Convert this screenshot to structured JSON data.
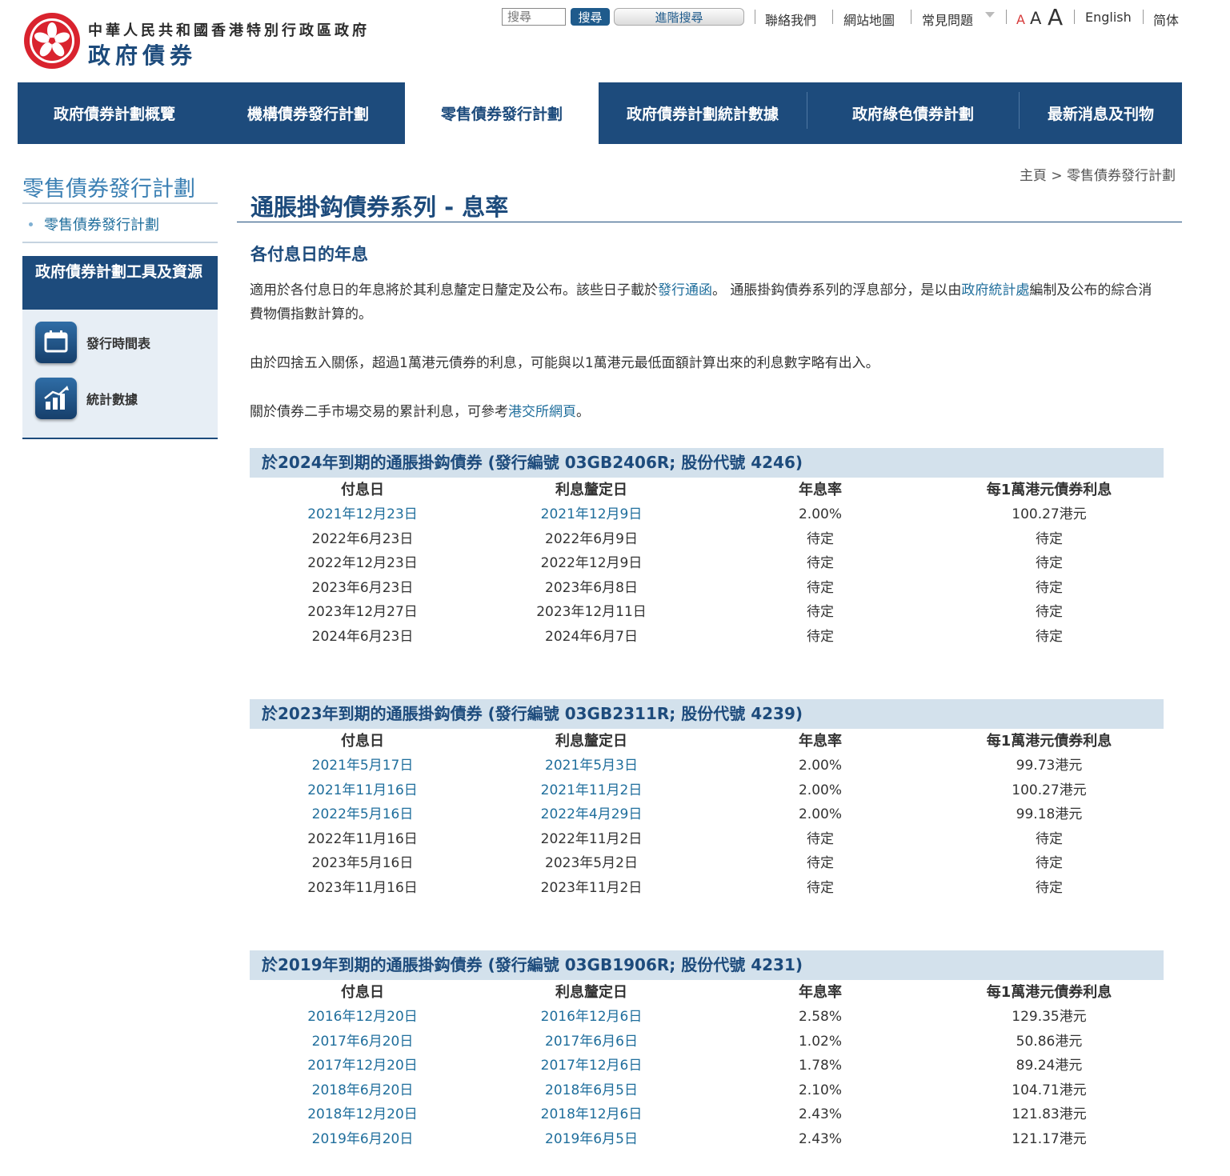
{
  "header": {
    "gov_name": "中華人民共和國香港特別行政區政府",
    "site_name": "政府債券",
    "search_placeholder": "搜尋",
    "search_button": "搜尋",
    "advanced_search": "進階搜尋",
    "links": {
      "contact": "聯絡我們",
      "sitemap": "網站地圖",
      "faq": "常見問題",
      "english": "English",
      "simplified": "简体"
    },
    "font_sizes": [
      "A",
      "A",
      "A"
    ]
  },
  "nav": {
    "tabs": [
      "政府債券計劃概覽",
      "機構債券發行計劃",
      "零售債券發行計劃",
      "政府債券計劃統計數據",
      "政府綠色債券計劃",
      "最新消息及刊物"
    ],
    "active_index": 2
  },
  "sidebar": {
    "title": "零售債券發行計劃",
    "link": "零售債券發行計劃",
    "tools_title": "政府債券計劃工具及資源",
    "tools": [
      {
        "label": "發行時間表",
        "icon": "calendar-icon"
      },
      {
        "label": "統計數據",
        "icon": "bar-chart-icon"
      }
    ]
  },
  "breadcrumb": {
    "home": "主頁",
    "sep": ">",
    "current": "零售債券發行計劃"
  },
  "page": {
    "title": "通脹掛鈎債券系列 - 息率",
    "subheading": "各付息日的年息",
    "para1": {
      "t1": "適用於各付息日的年息將於其利息釐定日釐定及公布。該些日子載於",
      "link1": "發行通函",
      "t2": "。 通脹掛鈎債券系列的浮息部分，是以由",
      "link2": "政府統計處",
      "t3": "編制及公布的綜合消費物價指數計算的。"
    },
    "para2": "由於四捨五入關係，超過1萬港元債券的利息，可能與以1萬港元最低面額計算出來的利息數字略有出入。",
    "para3": {
      "t1": "關於債券二手市場交易的累計利息，可參考",
      "link": "港交所網頁",
      "t2": "。"
    }
  },
  "table_headers": [
    "付息日",
    "利息釐定日",
    "年息率",
    "每1萬港元債券利息"
  ],
  "bonds": [
    {
      "title": "於2024年到期的通脹掛鈎債券 (發行編號 03GB2406R; 股份代號 4246)",
      "rows": [
        {
          "pay": "2021年12月23日",
          "fix": "2021年12月9日",
          "rate": "2.00%",
          "interest": "100.27港元",
          "linked": true
        },
        {
          "pay": "2022年6月23日",
          "fix": "2022年6月9日",
          "rate": "待定",
          "interest": "待定",
          "linked": false
        },
        {
          "pay": "2022年12月23日",
          "fix": "2022年12月9日",
          "rate": "待定",
          "interest": "待定",
          "linked": false
        },
        {
          "pay": "2023年6月23日",
          "fix": "2023年6月8日",
          "rate": "待定",
          "interest": "待定",
          "linked": false
        },
        {
          "pay": "2023年12月27日",
          "fix": "2023年12月11日",
          "rate": "待定",
          "interest": "待定",
          "linked": false
        },
        {
          "pay": "2024年6月23日",
          "fix": "2024年6月7日",
          "rate": "待定",
          "interest": "待定",
          "linked": false
        }
      ]
    },
    {
      "title": "於2023年到期的通脹掛鈎債券 (發行編號 03GB2311R; 股份代號 4239)",
      "rows": [
        {
          "pay": "2021年5月17日",
          "fix": "2021年5月3日",
          "rate": "2.00%",
          "interest": "99.73港元",
          "linked": true
        },
        {
          "pay": "2021年11月16日",
          "fix": "2021年11月2日",
          "rate": "2.00%",
          "interest": "100.27港元",
          "linked": true
        },
        {
          "pay": "2022年5月16日",
          "fix": "2022年4月29日",
          "rate": "2.00%",
          "interest": "99.18港元",
          "linked": true
        },
        {
          "pay": "2022年11月16日",
          "fix": "2022年11月2日",
          "rate": "待定",
          "interest": "待定",
          "linked": false
        },
        {
          "pay": "2023年5月16日",
          "fix": "2023年5月2日",
          "rate": "待定",
          "interest": "待定",
          "linked": false
        },
        {
          "pay": "2023年11月16日",
          "fix": "2023年11月2日",
          "rate": "待定",
          "interest": "待定",
          "linked": false
        }
      ]
    },
    {
      "title": "於2019年到期的通脹掛鈎債券 (發行編號 03GB1906R; 股份代號 4231)",
      "rows": [
        {
          "pay": "2016年12月20日",
          "fix": "2016年12月6日",
          "rate": "2.58%",
          "interest": "129.35港元",
          "linked": true
        },
        {
          "pay": "2017年6月20日",
          "fix": "2017年6月6日",
          "rate": "1.02%",
          "interest": "50.86港元",
          "linked": true
        },
        {
          "pay": "2017年12月20日",
          "fix": "2017年12月6日",
          "rate": "1.78%",
          "interest": "89.24港元",
          "linked": true
        },
        {
          "pay": "2018年6月20日",
          "fix": "2018年6月5日",
          "rate": "2.10%",
          "interest": "104.71港元",
          "linked": true
        },
        {
          "pay": "2018年12月20日",
          "fix": "2018年12月6日",
          "rate": "2.43%",
          "interest": "121.83港元",
          "linked": true
        },
        {
          "pay": "2019年6月20日",
          "fix": "2019年6月5日",
          "rate": "2.43%",
          "interest": "121.17港元",
          "linked": true
        }
      ]
    }
  ],
  "colors": {
    "brand": "#1d4b7c",
    "link": "#1f6e9c",
    "bond_header_bg": "#d3e1ec",
    "emblem": "#d9232e"
  }
}
